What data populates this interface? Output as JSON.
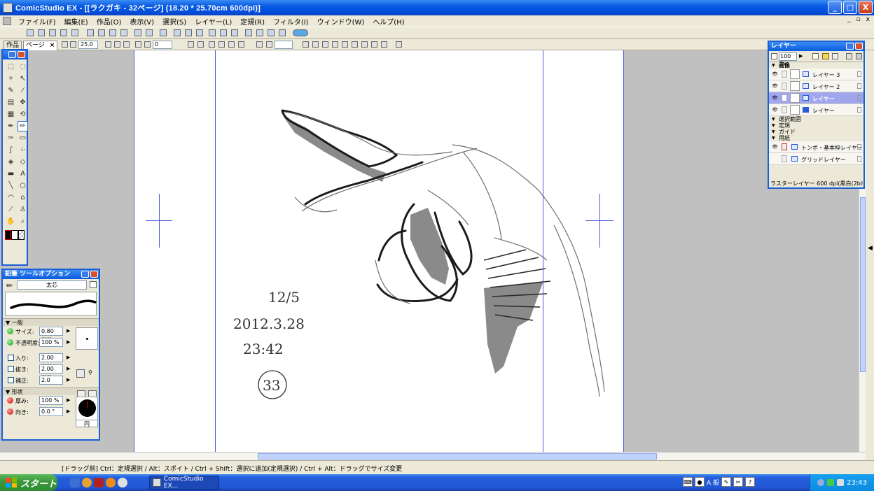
{
  "titlebar": {
    "title": "ComicStudio EX - [[ラクガキ - 32ページ] (18.20 * 25.70cm 600dpi)]",
    "min": "_",
    "max": "□",
    "close": "X"
  },
  "menu": {
    "items": [
      "ファイル(F)",
      "編集(E)",
      "作品(O)",
      "表示(V)",
      "選択(S)",
      "レイヤー(L)",
      "定規(R)",
      "フィルタ(I)",
      "ウィンドウ(W)",
      "ヘルプ(H)"
    ],
    "mdi_min": "_",
    "mdi_restore": "▫",
    "mdi_close": "x"
  },
  "toolbar2": {
    "tab_work": "作品",
    "tab_page": "ページ",
    "tab_close": "×",
    "zoom_value": "25.0",
    "rotate_value": "0"
  },
  "tool_palette": {
    "colors": {
      "main": "#000000",
      "sub": "#ffffff"
    }
  },
  "tool_options": {
    "title": "鉛筆 ツールオプション",
    "preset": "太芯",
    "section_general": "一般",
    "size_label": "サイズ:",
    "size_value": "0.80 mm",
    "opacity_label": "不透明度:",
    "opacity_value": "100 %",
    "in_label": "入り:",
    "in_value": "2.00 mm",
    "out_label": "抜き:",
    "out_value": "2.00 mm",
    "correction_label": "補正:",
    "correction_value": "2.0",
    "section_shape": "形状",
    "thickness_label": "厚み:",
    "thickness_value": "100 %",
    "direction_label": "向き:",
    "direction_value": "0.0 °",
    "shape_name": "円"
  },
  "layers": {
    "title": "レイヤー",
    "opacity": "100 %",
    "folder_image": "画像",
    "items": [
      {
        "name": "レイヤー 3"
      },
      {
        "name": "レイヤー 2"
      },
      {
        "name": "レイヤー"
      },
      {
        "name": "レイヤー"
      }
    ],
    "folder_selection": "選択範囲",
    "folder_ruler": "定規",
    "folder_guide": "ガイド",
    "folder_paper": "用紙",
    "paper_items": [
      {
        "name": "トンボ・基本枠レイヤー"
      },
      {
        "name": "グリッドレイヤー"
      }
    ],
    "status": "ラスターレイヤー 600 dpi(黒白(2bit))..."
  },
  "canvas": {
    "handwriting": [
      "12/5",
      "2012.3.28",
      "23:42",
      "33"
    ]
  },
  "statusbar": {
    "text": "[ドラッグ前] Ctrl：定規選択 / Alt：スポイト / Ctrl + Shift：選択に追加(定規選択) / Ctrl + Alt：ドラッグでサイズ変更"
  },
  "taskbar": {
    "start": "スタート",
    "task_item": "ComicStudio EX...",
    "ime_mode": "A 般",
    "clock": "23:43"
  }
}
